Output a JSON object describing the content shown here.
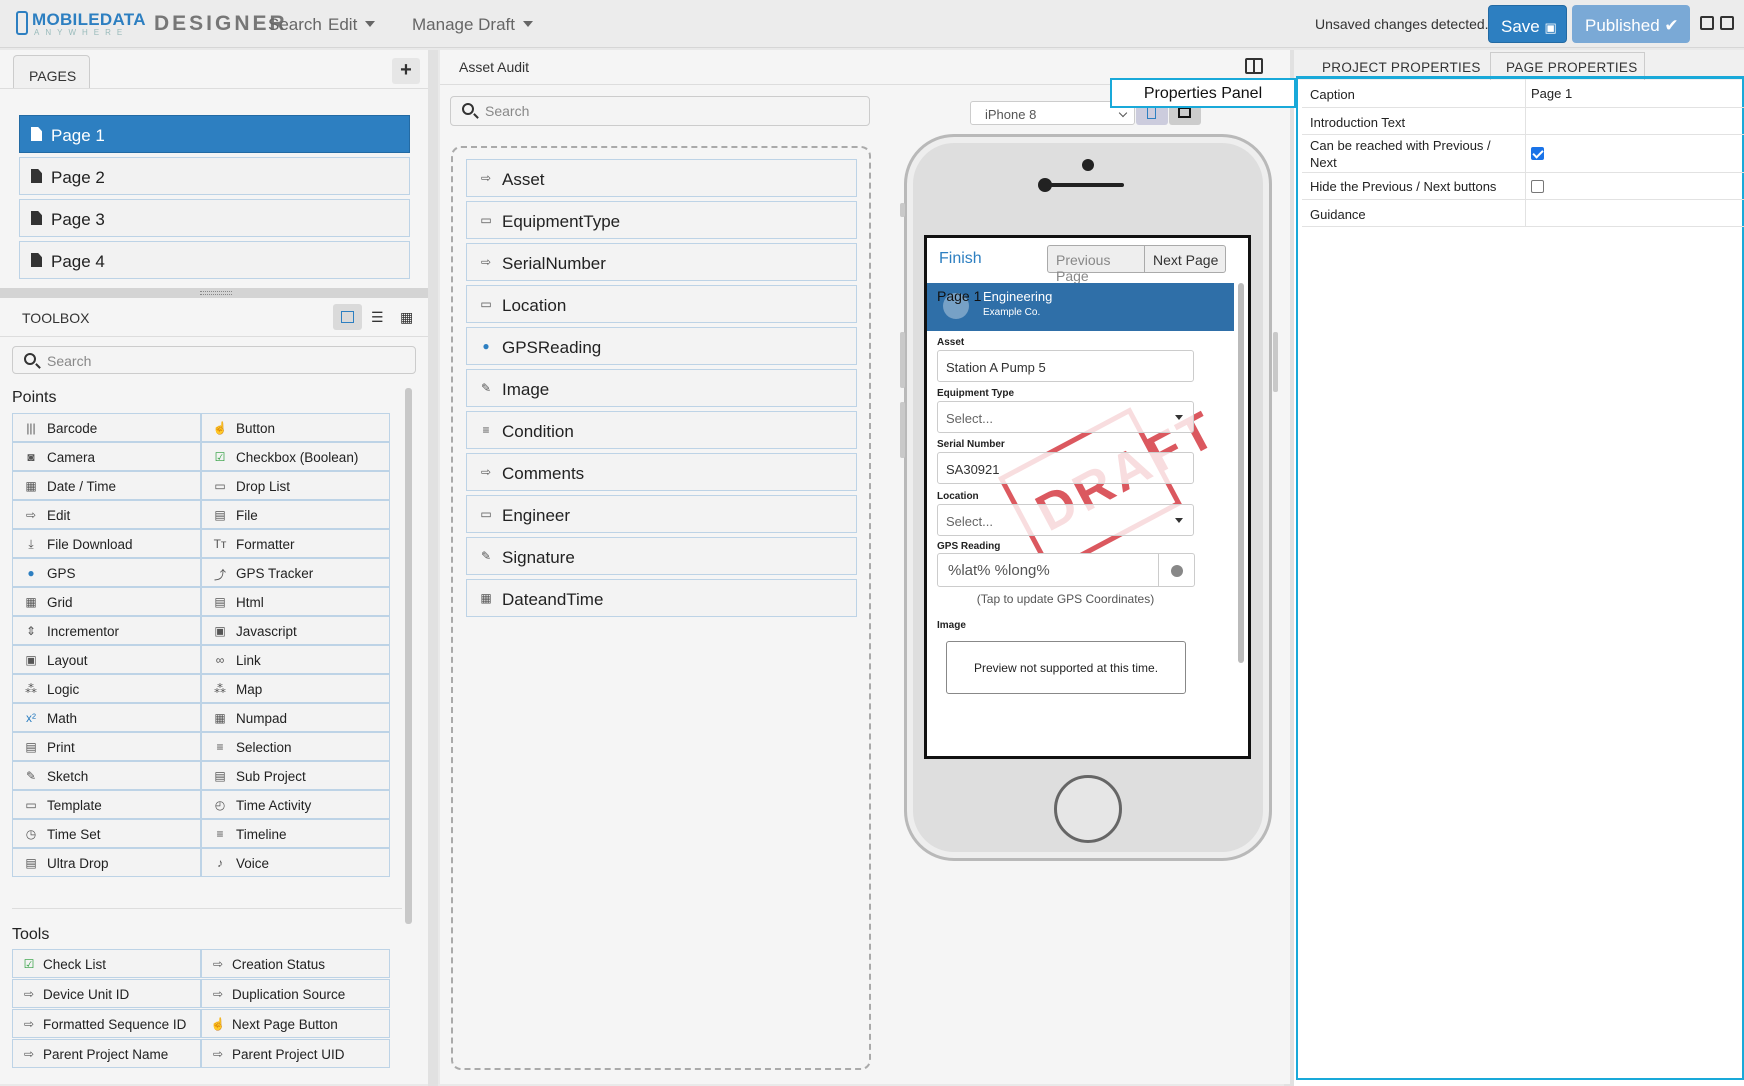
{
  "header": {
    "logo_main": "MOBILEDATA",
    "logo_sub": "ANYWHERE",
    "app_name": "DESIGNER",
    "menu": {
      "search": "Search",
      "edit": "Edit",
      "manage_draft": "Manage Draft"
    },
    "unsaved_text": "Unsaved changes detected.",
    "save_label": "Save",
    "published_label": "Published"
  },
  "pages_panel": {
    "tab_label": "PAGES",
    "add_label": "+",
    "items": [
      {
        "label": "Page 1",
        "active": true
      },
      {
        "label": "Page 2"
      },
      {
        "label": "Page 3"
      },
      {
        "label": "Page 4"
      }
    ]
  },
  "toolbox": {
    "title": "TOOLBOX",
    "search_placeholder": "Search",
    "points_title": "Points",
    "points": [
      {
        "label": "Barcode",
        "icon": "barcode-icon",
        "glyph": "|||"
      },
      {
        "label": "Button",
        "icon": "button-icon",
        "glyph": "☝"
      },
      {
        "label": "Camera",
        "icon": "camera-icon",
        "glyph": "◙"
      },
      {
        "label": "Checkbox (Boolean)",
        "icon": "checkbox-icon",
        "glyph": "☑"
      },
      {
        "label": "Date / Time",
        "icon": "calendar-icon",
        "glyph": "▦"
      },
      {
        "label": "Drop List",
        "icon": "droplist-icon",
        "glyph": "▭"
      },
      {
        "label": "Edit",
        "icon": "edit-icon",
        "glyph": "⇨"
      },
      {
        "label": "File",
        "icon": "file-icon",
        "glyph": "▤"
      },
      {
        "label": "File Download",
        "icon": "file-download-icon",
        "glyph": "⤓"
      },
      {
        "label": "Formatter",
        "icon": "formatter-icon",
        "glyph": "Tт"
      },
      {
        "label": "GPS",
        "icon": "gps-pin-icon",
        "glyph": "●"
      },
      {
        "label": "GPS Tracker",
        "icon": "gps-tracker-icon",
        "glyph": "⤴"
      },
      {
        "label": "Grid",
        "icon": "grid-icon",
        "glyph": "▦"
      },
      {
        "label": "Html",
        "icon": "html-icon",
        "glyph": "▤"
      },
      {
        "label": "Incrementor",
        "icon": "incrementor-icon",
        "glyph": "⇕"
      },
      {
        "label": "Javascript",
        "icon": "javascript-icon",
        "glyph": "▣"
      },
      {
        "label": "Layout",
        "icon": "layout-icon",
        "glyph": "▣"
      },
      {
        "label": "Link",
        "icon": "link-icon",
        "glyph": "∞"
      },
      {
        "label": "Logic",
        "icon": "logic-icon",
        "glyph": "⁂"
      },
      {
        "label": "Map",
        "icon": "map-icon",
        "glyph": "⁂"
      },
      {
        "label": "Math",
        "icon": "math-icon",
        "glyph": "x²"
      },
      {
        "label": "Numpad",
        "icon": "numpad-icon",
        "glyph": "▦"
      },
      {
        "label": "Print",
        "icon": "print-icon",
        "glyph": "▤"
      },
      {
        "label": "Selection",
        "icon": "selection-icon",
        "glyph": "≡"
      },
      {
        "label": "Sketch",
        "icon": "sketch-icon",
        "glyph": "✎"
      },
      {
        "label": "Sub Project",
        "icon": "sub-project-icon",
        "glyph": "▤"
      },
      {
        "label": "Template",
        "icon": "template-icon",
        "glyph": "▭"
      },
      {
        "label": "Time Activity",
        "icon": "time-activity-icon",
        "glyph": "◴"
      },
      {
        "label": "Time Set",
        "icon": "clock-icon",
        "glyph": "◷"
      },
      {
        "label": "Timeline",
        "icon": "timeline-icon",
        "glyph": "≡"
      },
      {
        "label": "Ultra Drop",
        "icon": "ultra-drop-icon",
        "glyph": "▤"
      },
      {
        "label": "Voice",
        "icon": "microphone-icon",
        "glyph": "♪"
      }
    ],
    "tools_title": "Tools",
    "tools": [
      {
        "label": "Check List",
        "icon": "checklist-icon",
        "glyph": "☑"
      },
      {
        "label": "Creation Status",
        "icon": "edit-icon",
        "glyph": "⇨"
      },
      {
        "label": "Device Unit ID",
        "icon": "edit-icon",
        "glyph": "⇨"
      },
      {
        "label": "Duplication Source",
        "icon": "edit-icon",
        "glyph": "⇨"
      },
      {
        "label": "Formatted Sequence ID",
        "icon": "edit-icon",
        "glyph": "⇨"
      },
      {
        "label": "Next Page Button",
        "icon": "button-icon",
        "glyph": "☝"
      },
      {
        "label": "Parent Project Name",
        "icon": "edit-icon",
        "glyph": "⇨"
      },
      {
        "label": "Parent Project UID",
        "icon": "edit-icon",
        "glyph": "⇨"
      }
    ]
  },
  "center": {
    "title": "Asset Audit",
    "search_placeholder": "Search",
    "fields": [
      {
        "label": "Asset",
        "icon": "edit-icon",
        "glyph": "⇨"
      },
      {
        "label": "EquipmentType",
        "icon": "droplist-icon",
        "glyph": "▭"
      },
      {
        "label": "SerialNumber",
        "icon": "edit-icon",
        "glyph": "⇨"
      },
      {
        "label": "Location",
        "icon": "droplist-icon",
        "glyph": "▭"
      },
      {
        "label": "GPSReading",
        "icon": "gps-pin-icon",
        "glyph": "●"
      },
      {
        "label": "Image",
        "icon": "sketch-icon",
        "glyph": "✎"
      },
      {
        "label": "Condition",
        "icon": "selection-icon",
        "glyph": "≡"
      },
      {
        "label": "Comments",
        "icon": "edit-icon",
        "glyph": "⇨"
      },
      {
        "label": "Engineer",
        "icon": "droplist-icon",
        "glyph": "▭"
      },
      {
        "label": "Signature",
        "icon": "sketch-icon",
        "glyph": "✎"
      },
      {
        "label": "DateandTime",
        "icon": "calendar-icon",
        "glyph": "▦"
      }
    ],
    "device": "iPhone 8"
  },
  "preview": {
    "finish": "Finish",
    "previous_page": "Previous Page",
    "next_page": "Next Page",
    "banner_page": "Page 1",
    "banner_title": "Engineering",
    "banner_subtitle": "Example Co.",
    "stamp_text": "DRAFT",
    "asset_label": "Asset",
    "asset_value": "Station A Pump 5",
    "equipment_label": "Equipment Type",
    "equipment_value": "Select...",
    "serial_label": "Serial Number",
    "serial_value": "SA30921",
    "location_label": "Location",
    "location_value": "Select...",
    "gps_label": "GPS Reading",
    "gps_value": "%lat% %long%",
    "gps_hint": "(Tap to update GPS Coordinates)",
    "image_label": "Image",
    "image_preview": "Preview not supported at this time."
  },
  "properties": {
    "tab_project": "PROJECT PROPERTIES",
    "tab_page": "PAGE PROPERTIES",
    "callout": "Properties Panel",
    "rows": {
      "caption_label": "Caption",
      "caption_value": "Page 1",
      "intro_label": "Introduction Text",
      "reach_label": "Can be reached with Previous / Next",
      "reach_checked": true,
      "hide_label": "Hide the Previous / Next buttons",
      "hide_checked": false,
      "guidance_label": "Guidance"
    }
  },
  "colors": {
    "accent": "#2d7fc1",
    "highlight_frame": "#19a9d9",
    "published": "#7aa9d6",
    "stamp": "#d0212a"
  }
}
